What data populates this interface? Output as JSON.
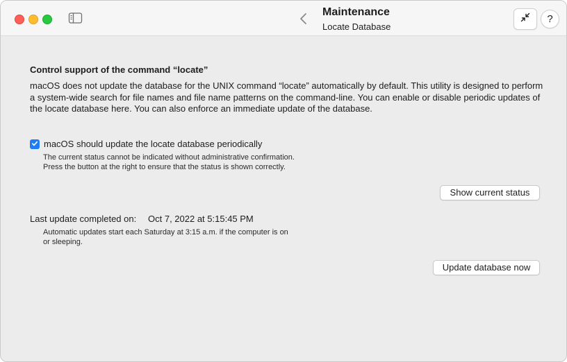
{
  "window": {
    "title": "Maintenance",
    "subtitle": "Locate Database",
    "help_label": "?"
  },
  "icons": {
    "sidebar_toggle": "sidebar-icon",
    "back": "chevron-left-icon",
    "collapse": "arrows-inward-icon",
    "checkmark": "checkmark-icon"
  },
  "section": {
    "heading": "Control support of the command “locate”",
    "description": "macOS does not update the database for the UNIX command “locate” automatically by default. This utility is designed to perform a system-wide search for file names and file name patterns on the command-line. You can enable or disable periodic updates of the locate database here. You can also enforce an immediate update of the database."
  },
  "periodic": {
    "checked": true,
    "label": "macOS should update the locate database periodically",
    "note_line1": "The current status cannot be indicated without administrative confirmation.",
    "note_line2": "Press the button at the right to ensure that the status is shown correctly.",
    "button_label": "Show current status"
  },
  "last_update": {
    "label": "Last update completed on:",
    "value": "Oct 7, 2022 at 5:15:45 PM",
    "note_line1": "Automatic updates start each Saturday at 3:15 a.m. if the computer is on",
    "note_line2": "or sleeping.",
    "button_label": "Update database now"
  },
  "colors": {
    "accent": "#1f7cf5",
    "close": "#fe5f57",
    "minimize": "#febc2e",
    "zoom": "#28c840"
  }
}
